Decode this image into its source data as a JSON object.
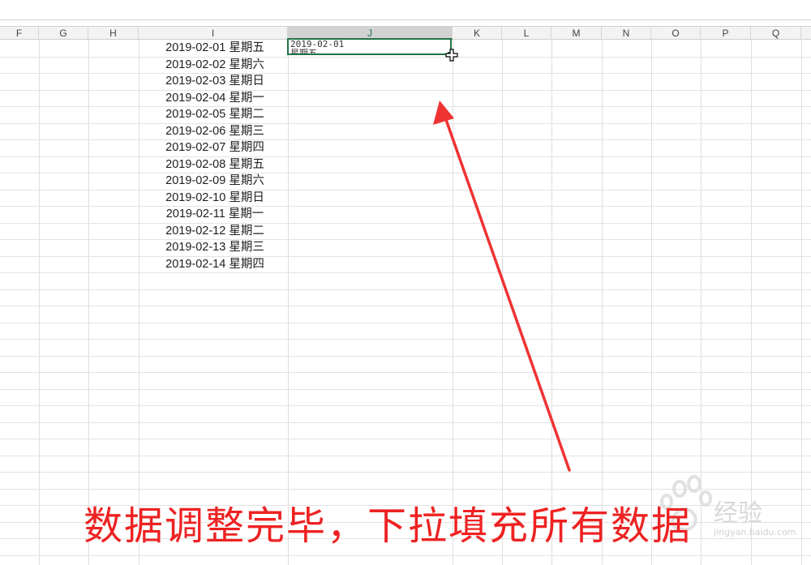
{
  "columns": [
    "F",
    "G",
    "H",
    "I",
    "J",
    "K",
    "L",
    "M",
    "N",
    "O",
    "P",
    "Q"
  ],
  "selected_column": "J",
  "column_i_values": [
    "2019-02-01 星期五",
    "2019-02-02 星期六",
    "2019-02-03 星期日",
    "2019-02-04 星期一",
    "2019-02-05 星期二",
    "2019-02-06 星期三",
    "2019-02-07 星期四",
    "2019-02-08 星期五",
    "2019-02-09 星期六",
    "2019-02-10 星期日",
    "2019-02-11 星期一",
    "2019-02-12 星期二",
    "2019-02-13 星期三",
    "2019-02-14 星期四"
  ],
  "active_cell": {
    "line1": "2019-02-01",
    "line2": "星期五"
  },
  "caption": "数据调整完毕，下拉填充所有数据",
  "watermark": {
    "text": "经验",
    "sub": "jingyan.baidu.com"
  },
  "colors": {
    "selection": "#217346",
    "annotation": "#ee2222"
  },
  "icons": {
    "cursor": "fill-cursor-icon",
    "arrow": "annotation-arrow"
  }
}
